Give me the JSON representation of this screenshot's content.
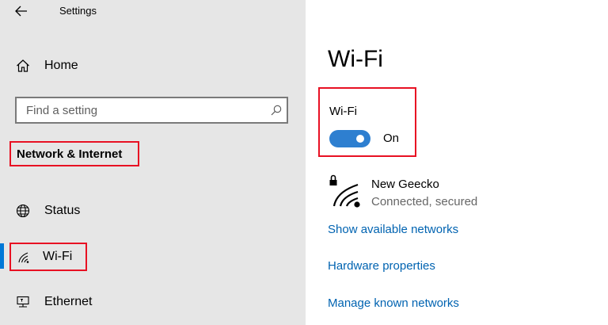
{
  "window": {
    "title": "Settings"
  },
  "sidebar": {
    "back_icon": "arrow-left-icon",
    "home": {
      "label": "Home",
      "icon": "home-icon"
    },
    "search": {
      "placeholder": "Find a setting",
      "value": "",
      "icon": "search-icon"
    },
    "section_title": "Network & Internet",
    "items": [
      {
        "label": "Status",
        "icon": "globe-icon"
      },
      {
        "label": "Wi-Fi",
        "icon": "wifi-icon",
        "selected": true
      },
      {
        "label": "Ethernet",
        "icon": "ethernet-icon"
      }
    ]
  },
  "main": {
    "title": "Wi-Fi",
    "wifi_toggle": {
      "label": "Wi-Fi",
      "state": "On",
      "on": true
    },
    "network": {
      "name": "New Geecko",
      "status": "Connected, secured",
      "icon": "wifi-secured-icon"
    },
    "links": {
      "show_networks": "Show available networks",
      "hardware": "Hardware properties",
      "manage_known": "Manage known networks"
    }
  },
  "colors": {
    "sidebar_bg": "#e6e6e6",
    "accent": "#0078d7",
    "toggle_on": "#2e7fd0",
    "link": "#0063b1",
    "highlight_border": "#e81123"
  }
}
